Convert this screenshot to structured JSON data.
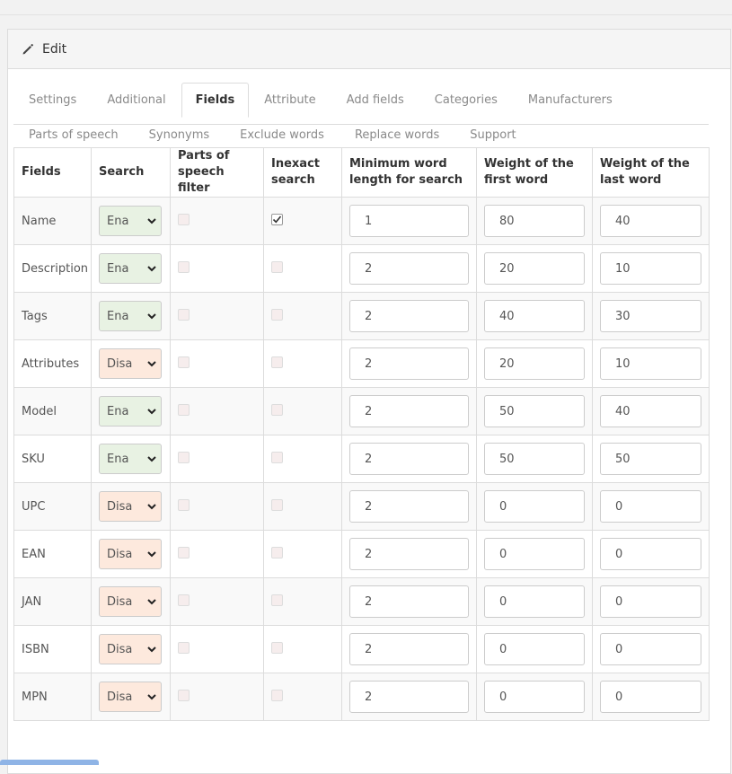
{
  "panel": {
    "title": "Edit",
    "icon": "pencil-icon"
  },
  "tabs_row1": [
    {
      "label": "Settings",
      "active": false
    },
    {
      "label": "Additional",
      "active": false
    },
    {
      "label": "Fields",
      "active": true
    },
    {
      "label": "Attribute",
      "active": false
    },
    {
      "label": "Add fields",
      "active": false
    },
    {
      "label": "Categories",
      "active": false
    },
    {
      "label": "Manufacturers",
      "active": false
    }
  ],
  "tabs_row2": [
    {
      "label": "Parts of speech",
      "active": false
    },
    {
      "label": "Synonyms",
      "active": false
    },
    {
      "label": "Exclude words",
      "active": false
    },
    {
      "label": "Replace words",
      "active": false
    },
    {
      "label": "Support",
      "active": false
    }
  ],
  "table": {
    "columns": [
      "Fields",
      "Search",
      "Parts of speech filter",
      "Inexact search",
      "Minimum word length for search",
      "Weight of the first word",
      "Weight of the last word"
    ],
    "rows": [
      {
        "field": "Name",
        "search": "Ena",
        "search_full": "Enabled",
        "pos_filter": false,
        "inexact": true,
        "min_len": "1",
        "w_first": "80",
        "w_last": "40"
      },
      {
        "field": "Description",
        "search": "Ena",
        "search_full": "Enabled",
        "pos_filter": false,
        "inexact": false,
        "min_len": "2",
        "w_first": "20",
        "w_last": "10"
      },
      {
        "field": "Tags",
        "search": "Ena",
        "search_full": "Enabled",
        "pos_filter": false,
        "inexact": false,
        "min_len": "2",
        "w_first": "40",
        "w_last": "30"
      },
      {
        "field": "Attributes",
        "search": "Disa",
        "search_full": "Disabled",
        "pos_filter": false,
        "inexact": false,
        "min_len": "2",
        "w_first": "20",
        "w_last": "10"
      },
      {
        "field": "Model",
        "search": "Ena",
        "search_full": "Enabled",
        "pos_filter": false,
        "inexact": false,
        "min_len": "2",
        "w_first": "50",
        "w_last": "40"
      },
      {
        "field": "SKU",
        "search": "Ena",
        "search_full": "Enabled",
        "pos_filter": false,
        "inexact": false,
        "min_len": "2",
        "w_first": "50",
        "w_last": "50"
      },
      {
        "field": "UPC",
        "search": "Disa",
        "search_full": "Disabled",
        "pos_filter": false,
        "inexact": false,
        "min_len": "2",
        "w_first": "0",
        "w_last": "0"
      },
      {
        "field": "EAN",
        "search": "Disa",
        "search_full": "Disabled",
        "pos_filter": false,
        "inexact": false,
        "min_len": "2",
        "w_first": "0",
        "w_last": "0"
      },
      {
        "field": "JAN",
        "search": "Disa",
        "search_full": "Disabled",
        "pos_filter": false,
        "inexact": false,
        "min_len": "2",
        "w_first": "0",
        "w_last": "0"
      },
      {
        "field": "ISBN",
        "search": "Disa",
        "search_full": "Disabled",
        "pos_filter": false,
        "inexact": false,
        "min_len": "2",
        "w_first": "0",
        "w_last": "0"
      },
      {
        "field": "MPN",
        "search": "Disa",
        "search_full": "Disabled",
        "pos_filter": false,
        "inexact": false,
        "min_len": "2",
        "w_first": "0",
        "w_last": "0"
      }
    ]
  },
  "colors": {
    "enabled_bg": "#e8f2e3",
    "disabled_bg": "#fde9dd",
    "active_tab_text": "#333333",
    "inactive_tab_text": "#8a8a8a"
  }
}
